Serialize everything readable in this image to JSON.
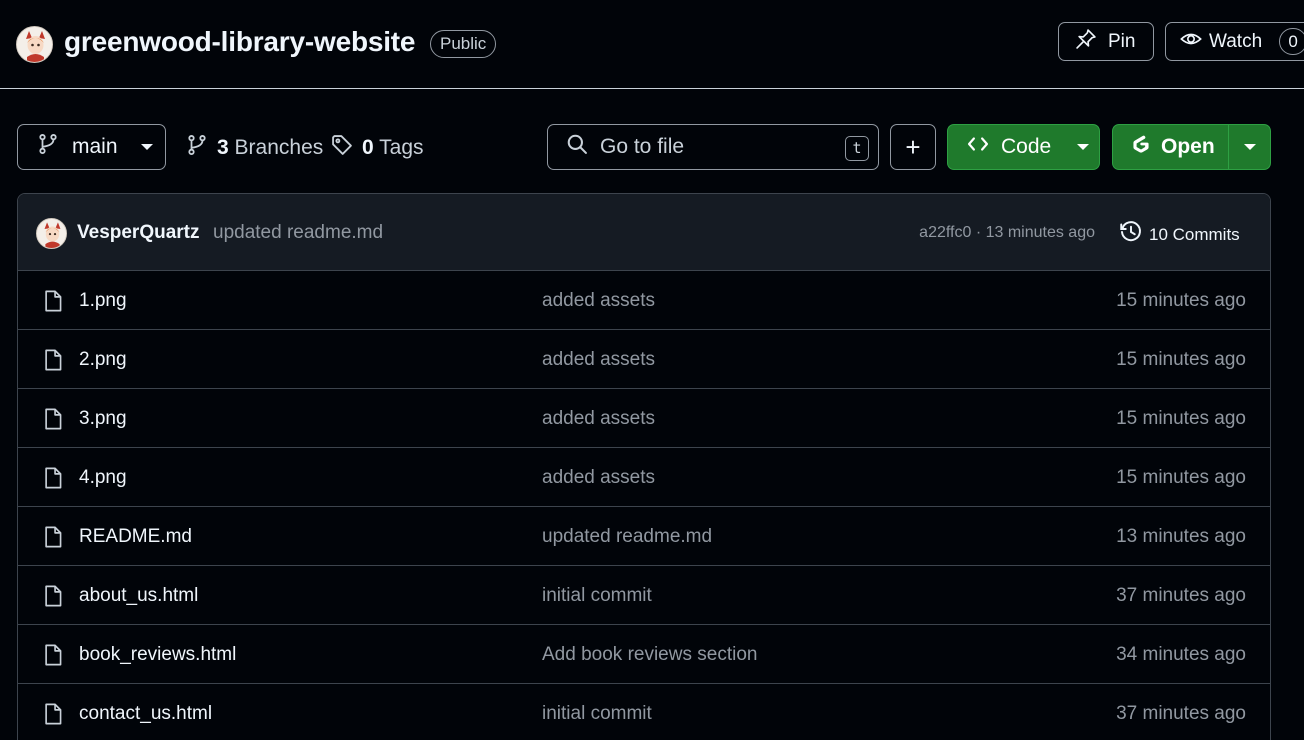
{
  "repo": {
    "name": "greenwood-library-website",
    "visibility": "Public"
  },
  "header_actions": {
    "pin_label": "Pin",
    "watch_label": "Watch",
    "watch_count": "0"
  },
  "toolbar": {
    "branch": "main",
    "branches_count": "3",
    "branches_label": "Branches",
    "tags_count": "0",
    "tags_label": "Tags",
    "search_placeholder": "Go to file",
    "search_shortcut": "t",
    "add_label": "+",
    "code_label": "Code",
    "open_label": "Open"
  },
  "latest_commit": {
    "author": "VesperQuartz",
    "message": "updated readme.md",
    "hash_time": "a22ffc0 · 13 minutes ago",
    "commits_label": "10 Commits"
  },
  "files": [
    {
      "name": "1.png",
      "message": "added assets",
      "time": "15 minutes ago"
    },
    {
      "name": "2.png",
      "message": "added assets",
      "time": "15 minutes ago"
    },
    {
      "name": "3.png",
      "message": "added assets",
      "time": "15 minutes ago"
    },
    {
      "name": "4.png",
      "message": "added assets",
      "time": "15 minutes ago"
    },
    {
      "name": "README.md",
      "message": "updated readme.md",
      "time": "13 minutes ago"
    },
    {
      "name": "about_us.html",
      "message": "initial commit",
      "time": "37 minutes ago"
    },
    {
      "name": "book_reviews.html",
      "message": "Add book reviews section",
      "time": "34 minutes ago"
    },
    {
      "name": "contact_us.html",
      "message": "initial commit",
      "time": "37 minutes ago"
    }
  ],
  "colors": {
    "background": "#010409",
    "header_bar": "#151b23",
    "border": "#3d444d",
    "primary_green": "#1f7a2c",
    "muted_text": "#9198a1"
  },
  "icons": {
    "pin": "pin-icon",
    "watch": "eye-icon",
    "branch": "git-branch-icon",
    "tag": "tag-icon",
    "search": "search-icon",
    "code": "code-icon",
    "open": "gitpod-icon",
    "history": "history-icon",
    "file": "file-icon"
  }
}
